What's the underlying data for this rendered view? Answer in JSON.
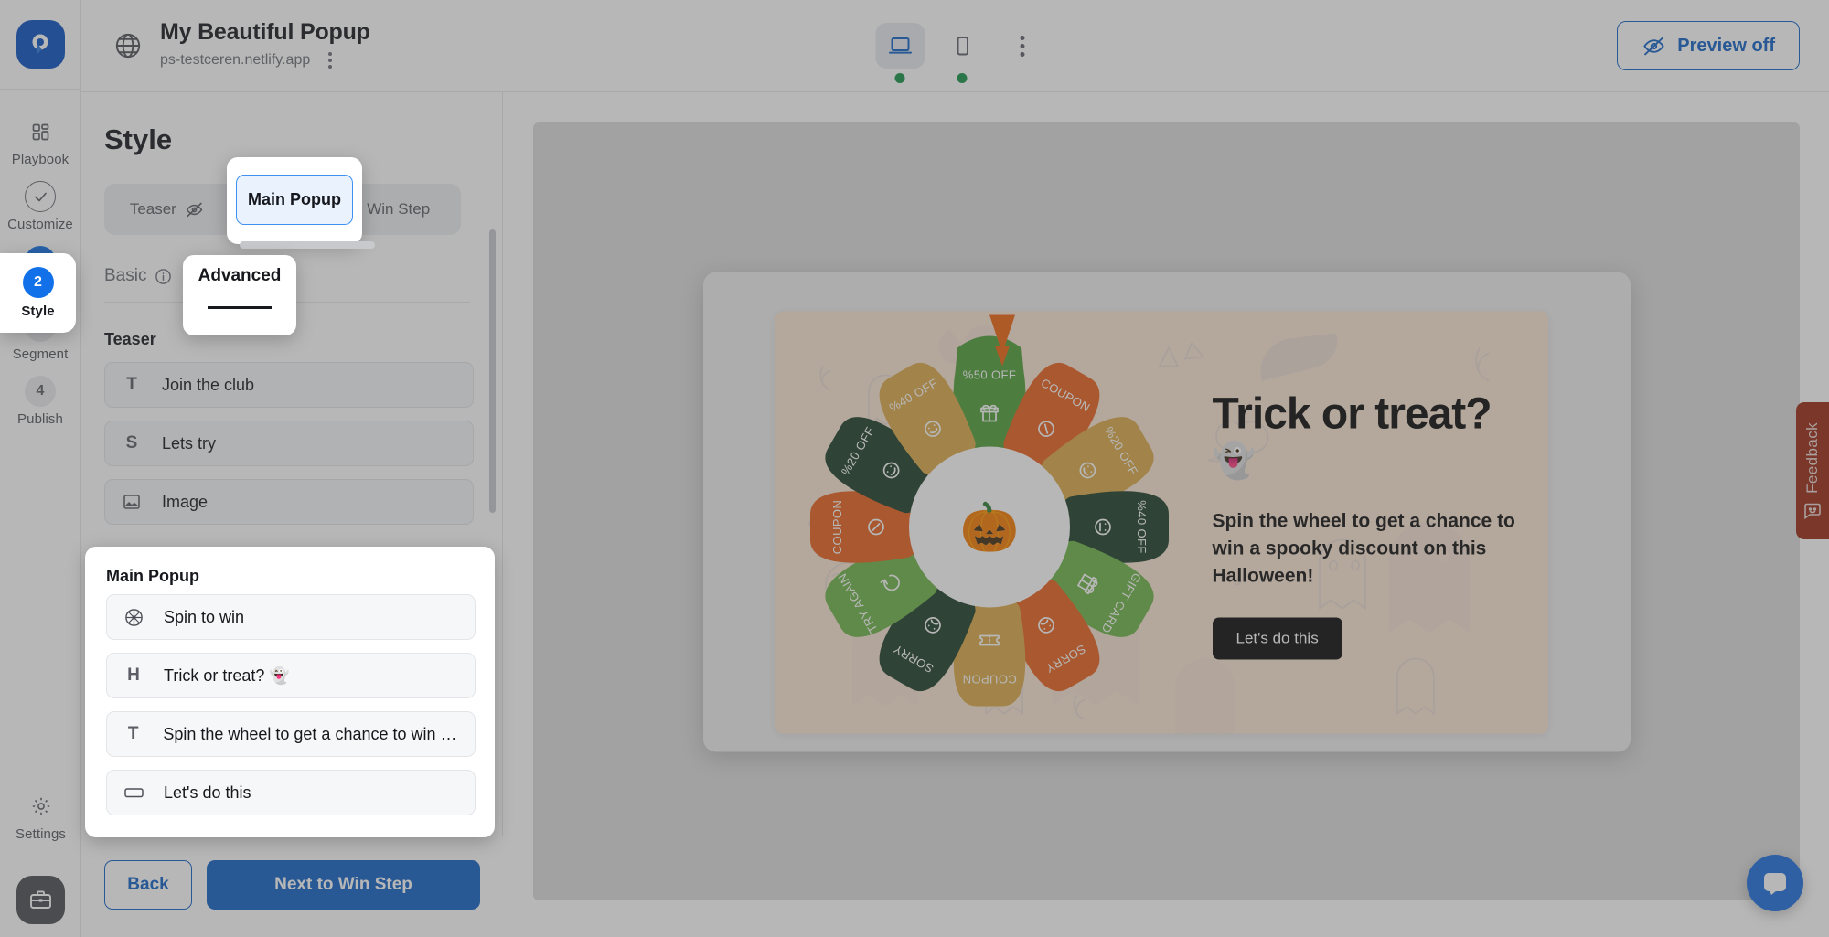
{
  "brand": {
    "accent": "#1363c6",
    "logo_icon": "popupsmart-logo"
  },
  "header": {
    "globe_icon": "globe-icon",
    "project_title": "My Beautiful Popup",
    "project_domain": "ps-testceren.netlify.app",
    "kebab_icon": "more-vertical-icon",
    "devices": [
      {
        "icon": "desktop-icon",
        "selected": true,
        "status": "online"
      },
      {
        "icon": "mobile-icon",
        "selected": false,
        "status": "online"
      }
    ],
    "more_icon": "more-vertical-icon",
    "preview_button": {
      "label": "Preview off",
      "icon": "eye-off-icon"
    }
  },
  "rail": {
    "items": [
      {
        "badge": "",
        "icon": "grid-icon",
        "label": "Playbook",
        "state": "icon"
      },
      {
        "badge": "",
        "icon": "check-circle-icon",
        "label": "Customize",
        "state": "done"
      },
      {
        "badge": "2",
        "icon": "",
        "label": "Style",
        "state": "active"
      },
      {
        "badge": "3",
        "icon": "",
        "label": "Segment",
        "state": "pending"
      },
      {
        "badge": "4",
        "icon": "",
        "label": "Publish",
        "state": "pending"
      }
    ],
    "settings": {
      "icon": "gear-icon",
      "label": "Settings"
    },
    "bottom_button_icon": "briefcase-icon"
  },
  "panel": {
    "title": "Style",
    "segment_tabs": [
      {
        "label": "Teaser",
        "icon": "eye-off-icon",
        "selected": false
      },
      {
        "label": "Main Popup",
        "icon": "",
        "selected": true
      },
      {
        "label": "Win Step",
        "icon": "",
        "selected": false
      }
    ],
    "sub_tabs": [
      {
        "label": "Basic",
        "icon": "info-icon",
        "selected": false
      },
      {
        "label": "Advanced",
        "icon": "",
        "selected": true
      }
    ],
    "teaser_group": {
      "title": "Teaser",
      "rows": [
        {
          "icon": "T",
          "icon_name": "text-icon",
          "label": "Join the club"
        },
        {
          "icon": "S",
          "icon_name": "subtitle-icon",
          "label": "Lets try"
        },
        {
          "icon": "IMG",
          "icon_name": "image-icon",
          "label": "Image"
        }
      ]
    },
    "main_popup_group": {
      "title": "Main Popup",
      "rows": [
        {
          "icon": "WHEEL",
          "icon_name": "wheel-icon",
          "label": "Spin to win"
        },
        {
          "icon": "H",
          "icon_name": "heading-icon",
          "label": "Trick or treat? 👻"
        },
        {
          "icon": "T",
          "icon_name": "text-icon",
          "label": "Spin the wheel to get a chance to win a ..."
        },
        {
          "icon": "BTN",
          "icon_name": "button-icon",
          "label": "Let's do this"
        }
      ]
    },
    "footer": {
      "back_label": "Back",
      "next_label": "Next to Win Step"
    }
  },
  "preview": {
    "close_icon": "close-icon",
    "heading": "Trick or treat?",
    "heading_emoji": "👻",
    "description": "Spin the wheel to get a chance to win a spooky discount on this Halloween!",
    "cta_label": "Let's do this",
    "center_emoji": "🎃",
    "pointer_color": "#f0640f",
    "background_color": "#fbe4d3",
    "wheel_segments": [
      {
        "index": 0,
        "label": "%50 OFF",
        "icon": "gift-icon",
        "color": "#4fa038"
      },
      {
        "index": 1,
        "label": "COUPON",
        "icon": "discount-icon",
        "color": "#e9621f"
      },
      {
        "index": 2,
        "label": "%20 OFF",
        "icon": "smile-icon",
        "color": "#dcab4a"
      },
      {
        "index": 3,
        "label": "%40 OFF",
        "icon": "neutral-icon",
        "color": "#1d4029"
      },
      {
        "index": 4,
        "label": "GIFT CARD",
        "icon": "gift-icon",
        "color": "#6fb548"
      },
      {
        "index": 5,
        "label": "SORRY",
        "icon": "sad-icon",
        "color": "#e9621f"
      },
      {
        "index": 6,
        "label": "COUPON",
        "icon": "ticket-icon",
        "color": "#dcab4a"
      },
      {
        "index": 7,
        "label": "SORRY",
        "icon": "sad-icon",
        "color": "#1d4029"
      },
      {
        "index": 8,
        "label": "TRY AGAIN",
        "icon": "refresh-icon",
        "color": "#6fb548"
      },
      {
        "index": 9,
        "label": "COUPON",
        "icon": "discount-icon",
        "color": "#e9621f"
      },
      {
        "index": 10,
        "label": "%20 OFF",
        "icon": "smile-icon",
        "color": "#1d4029"
      },
      {
        "index": 11,
        "label": "%40 OFF",
        "icon": "smile-icon",
        "color": "#dcab4a"
      }
    ]
  },
  "feedback": {
    "label": "Feedback",
    "icon": "chat-square-icon",
    "color": "#9c2a14"
  },
  "chat_fab": {
    "icon": "intercom-icon",
    "color": "#1d6fe0"
  }
}
